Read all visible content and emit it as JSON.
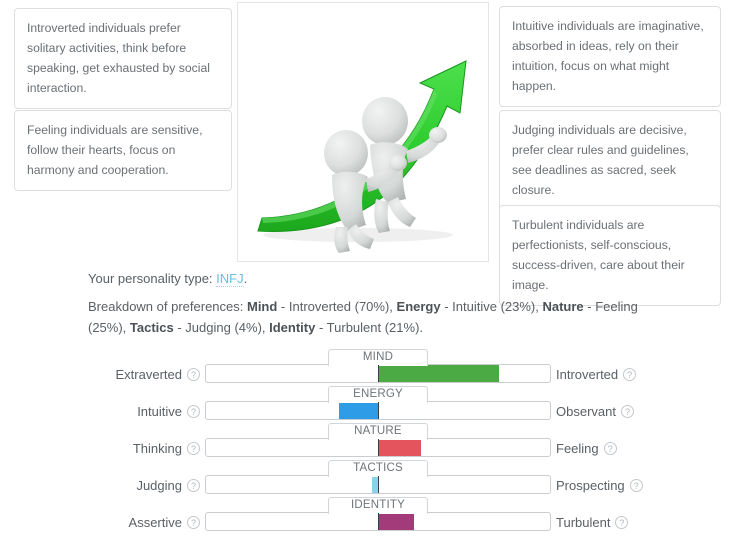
{
  "cards": {
    "left": [
      {
        "id": "introverted-description",
        "text": "Introverted individuals prefer solitary activities, think before speaking, get exhausted by social interaction."
      },
      {
        "id": "feeling-description",
        "text": "Feeling individuals are sensitive, follow their hearts, focus on harmony and cooperation."
      }
    ],
    "right": [
      {
        "id": "intuitive-description",
        "text": "Intuitive individuals are imaginative, absorbed in ideas, rely on their intuition, focus on what might happen."
      },
      {
        "id": "judging-description",
        "text": "Judging individuals are decisive, prefer clear rules and guidelines, see deadlines as sacred, seek closure."
      },
      {
        "id": "turbulent-description",
        "text": "Turbulent individuals are perfectionists, self-conscious, success-driven, care about their image."
      }
    ]
  },
  "hero": {
    "alt": "two gray 3d figures climbing a rising green arrow",
    "arrow_color": "#2db92d",
    "figure_color": "#d8dcda"
  },
  "summary": {
    "type_prefix": "Your personality type: ",
    "type_code": "INFJ",
    "type_suffix": ".",
    "breakdown_prefix": "Breakdown of preferences: ",
    "breakdown_parts": [
      {
        "label": "Mind",
        "value": " - Introverted (70%), "
      },
      {
        "label": "Energy",
        "value": " - Intuitive (23%), "
      },
      {
        "label": "Nature",
        "value": " - Feeling (25%), "
      },
      {
        "label": "Tactics",
        "value": " - Judging (4%), "
      },
      {
        "label": "Identity",
        "value": " - Turbulent (21%)."
      }
    ]
  },
  "help_icon": "?",
  "chart_data": {
    "type": "bar",
    "title": "Personality trait breakdown",
    "note": "Five bipolar trait scales; each bar is centered, fill extends from the midpoint toward the dominant pole by the given percentage of the half-width.",
    "axis_range": [
      -100,
      100
    ],
    "grid": false,
    "legend": "none",
    "traits": [
      {
        "name": "MIND",
        "left_label": "Extraverted",
        "right_label": "Introverted",
        "dominant": "Introverted",
        "direction": "right",
        "percent": 70,
        "color": "#4caa44"
      },
      {
        "name": "ENERGY",
        "left_label": "Intuitive",
        "right_label": "Observant",
        "dominant": "Intuitive",
        "direction": "left",
        "percent": 23,
        "color": "#2f9ce8"
      },
      {
        "name": "NATURE",
        "left_label": "Thinking",
        "right_label": "Feeling",
        "dominant": "Feeling",
        "direction": "right",
        "percent": 25,
        "color": "#e4545c"
      },
      {
        "name": "TACTICS",
        "left_label": "Judging",
        "right_label": "Prospecting",
        "dominant": "Judging",
        "direction": "left",
        "percent": 4,
        "color": "#88d3e8"
      },
      {
        "name": "IDENTITY",
        "left_label": "Assertive",
        "right_label": "Turbulent",
        "dominant": "Turbulent",
        "direction": "right",
        "percent": 21,
        "color": "#a33a7a"
      }
    ]
  }
}
